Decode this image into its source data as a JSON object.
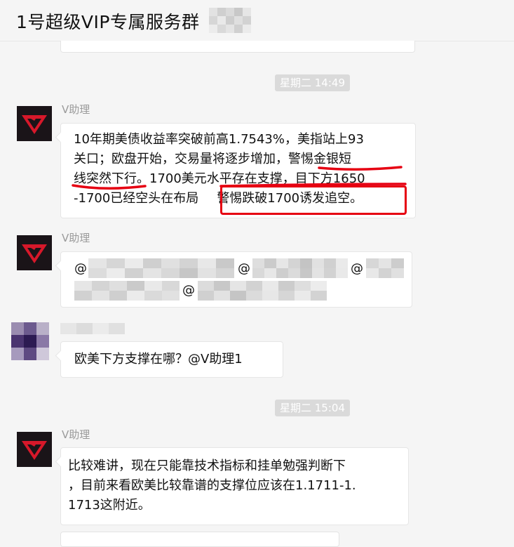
{
  "header": {
    "title": "1号超级VIP专属服务群"
  },
  "timestamps": [
    "星期二 14:49",
    "星期二 15:04"
  ],
  "messages": [
    {
      "sender": "V助理",
      "lines": [
        "10年期美债收益率突破前高1.7543%，美指站上93",
        "关口；欧盘开始，交易量将逐步增加，警惕金银短",
        "线突然下行。1700美元水平存在支撑，目下方1650",
        "-1700已经空头在布局"
      ],
      "highlight": "警惕跌破1700诱发追空。"
    },
    {
      "sender": "V助理",
      "mentions": [
        "@",
        "@",
        "@",
        "@"
      ]
    },
    {
      "text": "欧美下方支撑在哪？@V助理1"
    },
    {
      "sender": "V助理",
      "lines": [
        "比较难讲，现在只能靠技术指标和挂单勉强判断下",
        "，目前来看欧美比较靠谱的支撑位应该在1.1711-1.",
        "1713这附近。"
      ]
    }
  ],
  "colors": {
    "annotation_red": "#e60012",
    "avatar_bg": "#1a1418",
    "logo_red": "#d7182a"
  },
  "icons": {
    "assistant_avatar": "red-v-logo-icon"
  }
}
